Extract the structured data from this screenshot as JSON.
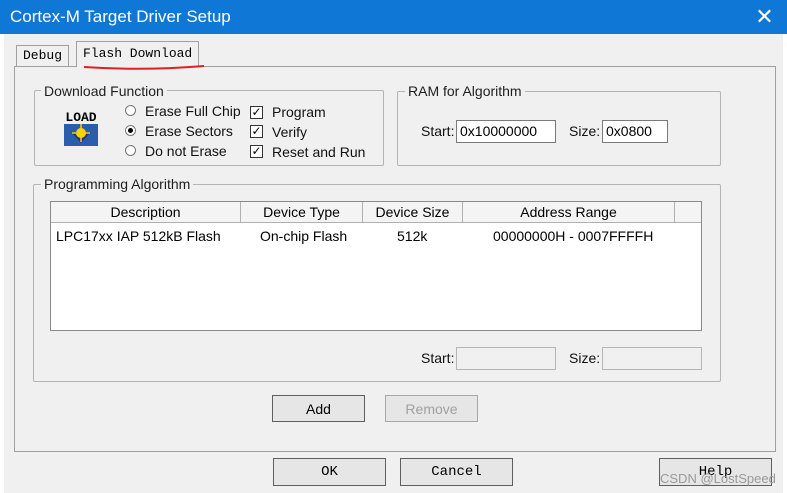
{
  "window": {
    "title": "Cortex-M Target Driver Setup",
    "close_glyph": "✕"
  },
  "tabs": [
    {
      "label": "Debug"
    },
    {
      "label": "Flash Download"
    }
  ],
  "download_function": {
    "title": "Download Function",
    "icon_text": "LOAD",
    "erase_options": [
      {
        "label": "Erase Full Chip",
        "selected": false
      },
      {
        "label": "Erase Sectors",
        "selected": true
      },
      {
        "label": "Do not Erase",
        "selected": false
      }
    ],
    "checks": [
      {
        "label": "Program",
        "checked": true
      },
      {
        "label": "Verify",
        "checked": true
      },
      {
        "label": "Reset and Run",
        "checked": true
      }
    ]
  },
  "ram": {
    "title": "RAM for Algorithm",
    "start_label": "Start:",
    "start_value": "0x10000000",
    "size_label": "Size:",
    "size_value": "0x0800"
  },
  "programming": {
    "title": "Programming Algorithm",
    "columns": [
      "Description",
      "Device Type",
      "Device Size",
      "Address Range"
    ],
    "rows": [
      [
        "LPC17xx IAP 512kB Flash",
        "On-chip Flash",
        "512k",
        "00000000H - 0007FFFFH"
      ]
    ],
    "start_label": "Start:",
    "start_value": "",
    "size_label": "Size:",
    "size_value": ""
  },
  "buttons": {
    "add": "Add",
    "remove": "Remove",
    "ok": "OK",
    "cancel": "Cancel",
    "help": "Help"
  },
  "watermark": "CSDN @LostSpeed",
  "colors": {
    "titlebar": "#0f78d7",
    "tab_underline": "#e02020"
  }
}
